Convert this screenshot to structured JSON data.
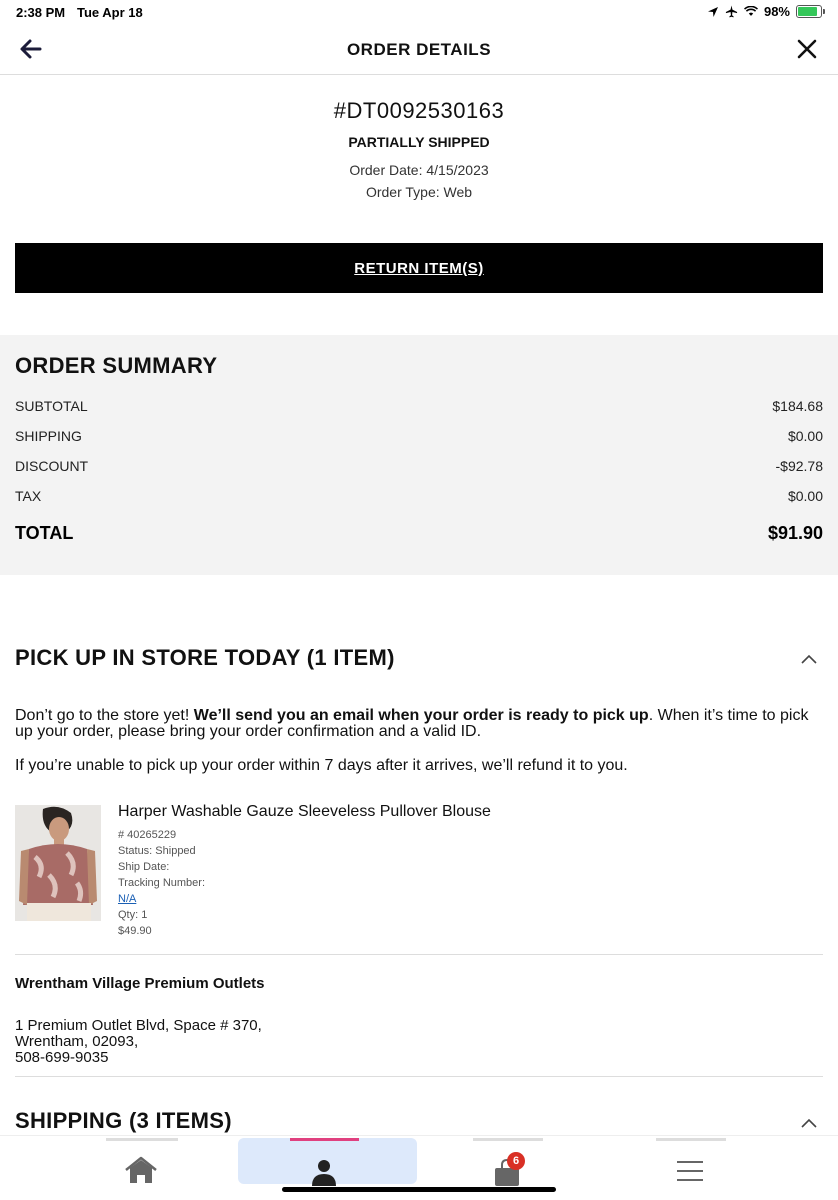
{
  "status_bar": {
    "time": "2:38 PM",
    "date": "Tue Apr 18",
    "battery": "98%"
  },
  "header": {
    "title": "ORDER DETAILS"
  },
  "order": {
    "number": "#DT0092530163",
    "status": "PARTIALLY SHIPPED",
    "date_text": "Order Date: 4/15/2023",
    "type_text": "Order Type: Web",
    "return_label": "RETURN ITEM(S)"
  },
  "summary": {
    "title": "ORDER SUMMARY",
    "rows": [
      {
        "label": "SUBTOTAL",
        "value": "$184.68"
      },
      {
        "label": "SHIPPING",
        "value": "$0.00"
      },
      {
        "label": "DISCOUNT",
        "value": "-$92.78"
      },
      {
        "label": "TAX",
        "value": "$0.00"
      }
    ],
    "total_label": "TOTAL",
    "total_value": "$91.90"
  },
  "pickup": {
    "title": "PICK UP IN STORE TODAY (1 ITEM)",
    "msg_a": "Don’t go to the store yet! ",
    "msg_bold": "We’ll send you an email when your order is ready to pick up",
    "msg_b": ". When it’s time to pick up your order, please bring your order confirmation and a valid ID.",
    "msg2": "If you’re unable to pick up your order within 7 days after it arrives, we’ll refund it to you.",
    "item": {
      "name": "Harper Washable Gauze Sleeveless Pullover Blouse",
      "sku": "# 40265229",
      "status": "Status: Shipped",
      "ship_date": "Ship Date:",
      "tracking_label": "Tracking Number:",
      "tracking_value": "N/A",
      "qty": "Qty: 1",
      "price": "$49.90"
    },
    "store": {
      "name": "Wrentham Village Premium Outlets",
      "address1": "1 Premium Outlet Blvd, Space # 370,",
      "address2": "Wrentham, 02093,",
      "phone": "508-699-9035"
    }
  },
  "shipping": {
    "title": "SHIPPING (3 ITEMS)"
  },
  "tabbar": {
    "cart_badge": "6",
    "active_tab": "account"
  },
  "colors": {
    "accent": "#e0407f",
    "active_tab_bg": "#dde9fb",
    "badge": "#d93025",
    "link": "#1a5fb4"
  }
}
